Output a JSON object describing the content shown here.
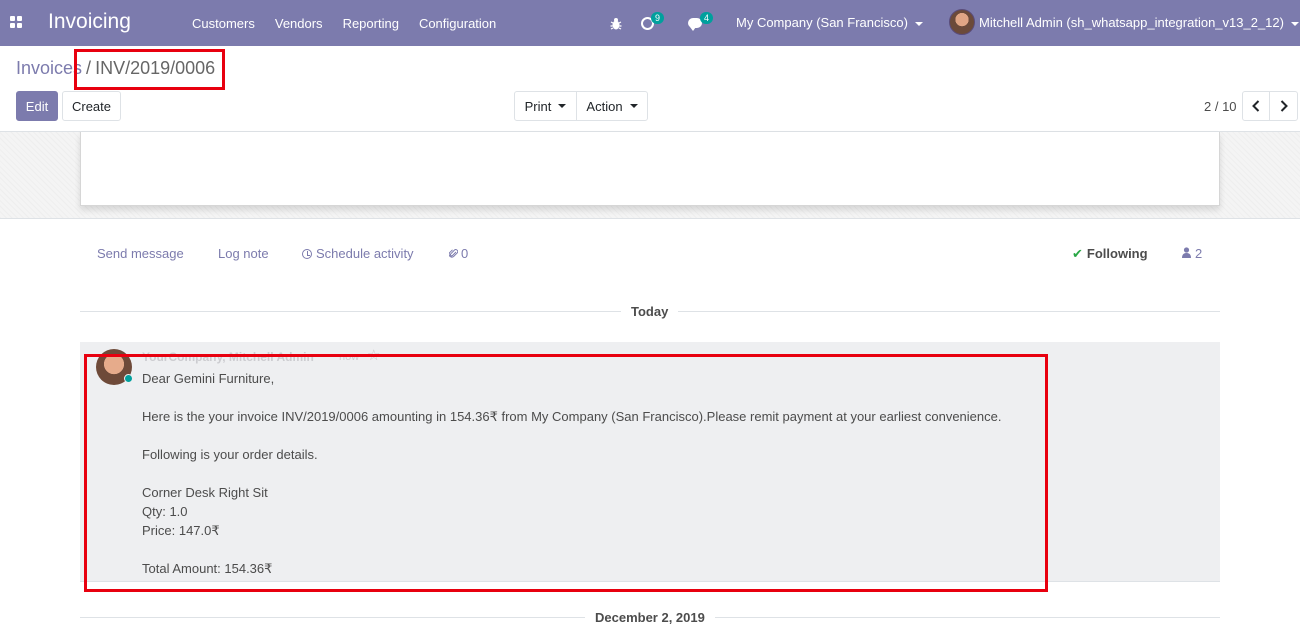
{
  "navbar": {
    "app_title": "Invoicing",
    "menu": [
      "Customers",
      "Vendors",
      "Reporting",
      "Configuration"
    ],
    "activity_count": "9",
    "messages_count": "4",
    "company": "My Company (San Francisco)",
    "user": "Mitchell Admin (sh_whatsapp_integration_v13_2_12)",
    "accent_color": "#7c7bad",
    "badge_color": "#00a09d"
  },
  "breadcrumb": {
    "parent": "Invoices",
    "separator": "/",
    "current": "INV/2019/0006"
  },
  "buttons": {
    "edit": "Edit",
    "create": "Create",
    "print": "Print",
    "action": "Action"
  },
  "pager": {
    "value": "2 / 10",
    "prev_icon": "chevron-left-icon",
    "next_icon": "chevron-right-icon"
  },
  "chatter": {
    "send_message": "Send message",
    "log_note": "Log note",
    "schedule_activity": "Schedule activity",
    "attachments_count": "0",
    "following": "Following",
    "followers_count": "2"
  },
  "date_separators": {
    "today": "Today",
    "older": "December 2, 2019"
  },
  "message": {
    "author": "YourCompany, Mitchell Admin",
    "date": "now",
    "lines": [
      "Dear Gemini Furniture,",
      "Here is the your invoice INV/2019/0006 amounting in 154.36₹ from My Company (San Francisco).Please remit payment at your earliest convenience.",
      "Following is your order details.",
      "Corner Desk Right Sit",
      "Qty: 1.0",
      "Price: 147.0₹",
      "Total Amount: 154.36₹"
    ]
  },
  "highlight_color": "#e8000f"
}
